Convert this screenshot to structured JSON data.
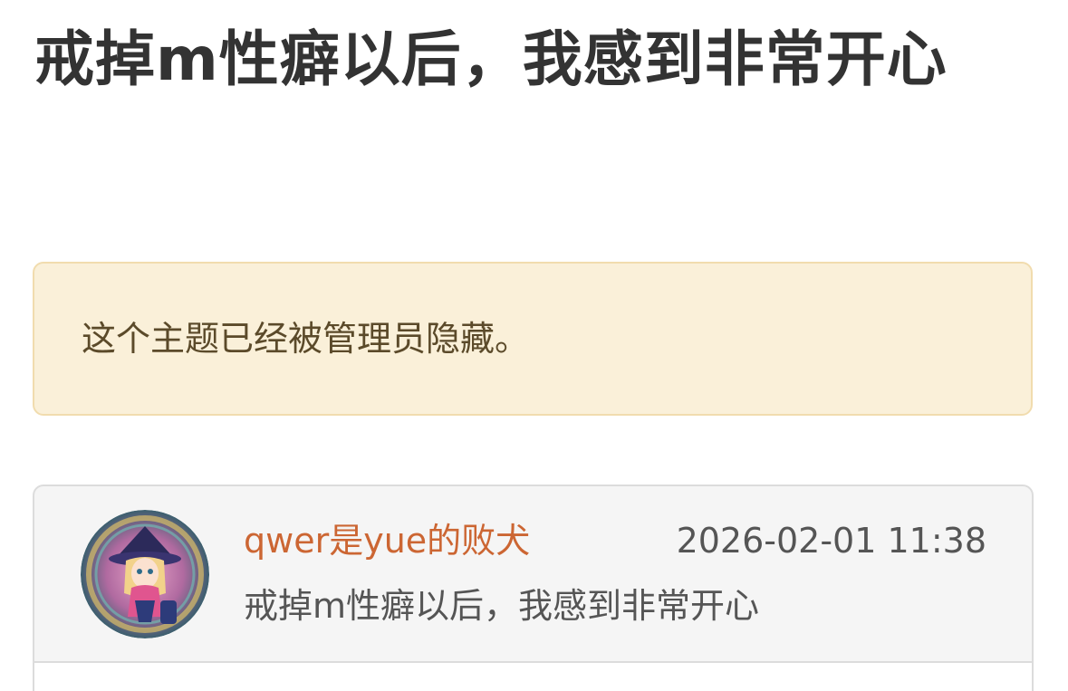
{
  "topic": {
    "title": "戒掉m性癖以后，我感到非常开心"
  },
  "notice": {
    "text": "这个主题已经被管理员隐藏。"
  },
  "post": {
    "author": "qwer是yue的败犬",
    "timestamp": "2026-02-01 11:38",
    "excerpt": "戒掉m性癖以后，我感到非常开心",
    "avatar_icon": "anime-avatar-icon"
  },
  "colors": {
    "notice_bg": "#faf0d9",
    "notice_border": "#f1dcae",
    "author": "#cc6633",
    "title": "#333333"
  }
}
